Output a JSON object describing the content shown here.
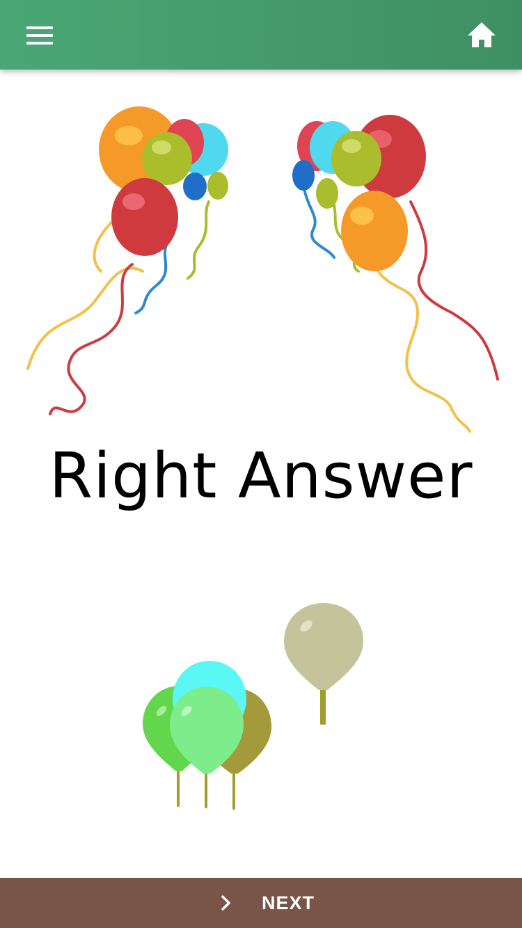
{
  "app_bar": {
    "menu_icon": "hamburger-menu-icon",
    "home_icon": "home-icon",
    "color": "#44a06e"
  },
  "result": {
    "headline": "Right Answer"
  },
  "decorations": {
    "top_balloons": "balloon-cluster-icon",
    "bottom_balloons": "floating-balloons-icon"
  },
  "bottom_bar": {
    "label": "NEXT",
    "icon": "chevron-right-icon",
    "color": "#795548"
  }
}
